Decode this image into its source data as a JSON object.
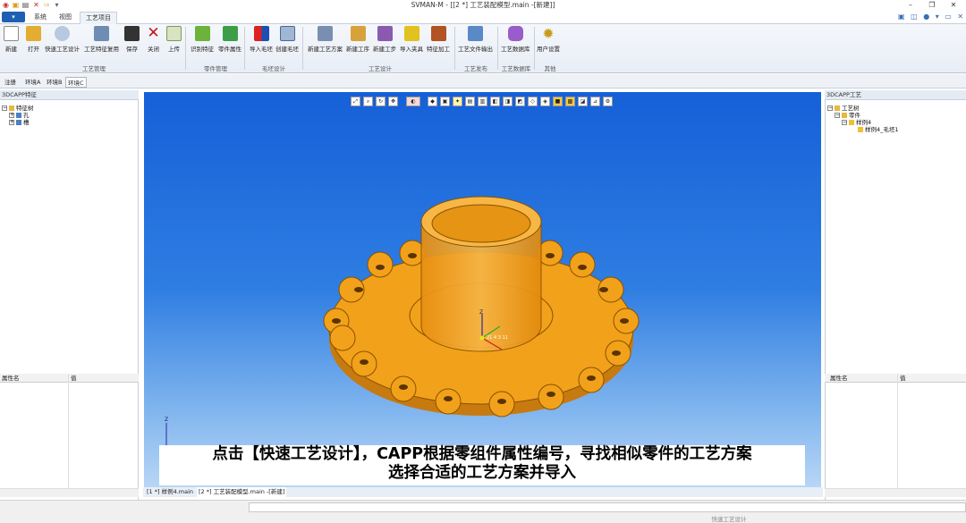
{
  "window": {
    "title": "SVMAN-M - [[2 *] 工艺装配模型.main -[新建]]",
    "app_button": "▾"
  },
  "quick_access": [
    "app-icon",
    "open-icon",
    "save-icon",
    "close-icon",
    "redo-icon",
    "dropdown-icon"
  ],
  "ribbon_tabs": [
    {
      "label": "系统"
    },
    {
      "label": "视图"
    },
    {
      "label": "工艺项目"
    }
  ],
  "ribbon": {
    "buttons": [
      {
        "label": "新建"
      },
      {
        "label": "打开"
      },
      {
        "label": "快速工艺设计"
      },
      {
        "label": "工艺特征复用"
      },
      {
        "label": "保存"
      },
      {
        "label": "关闭"
      },
      {
        "label": "上传"
      },
      {
        "label": "识别特征"
      },
      {
        "label": "零件属性"
      },
      {
        "label": "导入毛坯"
      },
      {
        "label": "创建毛坯"
      },
      {
        "label": "新建工艺方案"
      },
      {
        "label": "新建工序"
      },
      {
        "label": "新建工步"
      },
      {
        "label": "导入夹具"
      },
      {
        "label": "特征加工"
      },
      {
        "label": "工艺文件输出"
      },
      {
        "label": "工艺数据库"
      },
      {
        "label": "用户设置"
      }
    ],
    "groups": [
      {
        "label": "工艺管理"
      },
      {
        "label": "零件管理"
      },
      {
        "label": "毛坯设计"
      },
      {
        "label": "工艺设计"
      },
      {
        "label": "工艺发布"
      },
      {
        "label": "工艺数据库"
      },
      {
        "label": "其他"
      }
    ]
  },
  "env_tabs": [
    {
      "label": "注册"
    },
    {
      "label": "环境A"
    },
    {
      "label": "环境B"
    },
    {
      "label": "环境C"
    }
  ],
  "left_panel": {
    "header": "3DCAPP特征",
    "tree": [
      {
        "label": "特征树"
      },
      {
        "label": "孔"
      },
      {
        "label": "槽"
      }
    ],
    "props": {
      "col1": "属性名",
      "col2": "值"
    }
  },
  "right_panel": {
    "header": "3DCAPP工艺",
    "tree": [
      {
        "label": "工艺树"
      },
      {
        "label": "零件"
      },
      {
        "label": "样例4"
      },
      {
        "label": "样例4_毛坯1"
      }
    ],
    "props": {
      "col1": "属性名",
      "col2": "值"
    }
  },
  "viewport": {
    "axis_z": "Z",
    "axis_label": "21 4 3 11"
  },
  "subtitle": {
    "line1": "点击【快速工艺设计】，CAPP根据零组件属性编号，寻找相似零件的工艺方案",
    "line2": "选择合适的工艺方案并导入"
  },
  "doc_tabs": [
    {
      "label": "[1 *] 样例4.main"
    },
    {
      "label": "[2 *] 工艺装配模型.main -[新建]"
    }
  ],
  "status": {
    "text": "快速工艺设计"
  },
  "colors": {
    "ribbon_bg": "#eef3fa",
    "viewport_top": "#1560d8",
    "part_orange": "#f2a11a",
    "app_button": "#1e5fb3"
  }
}
